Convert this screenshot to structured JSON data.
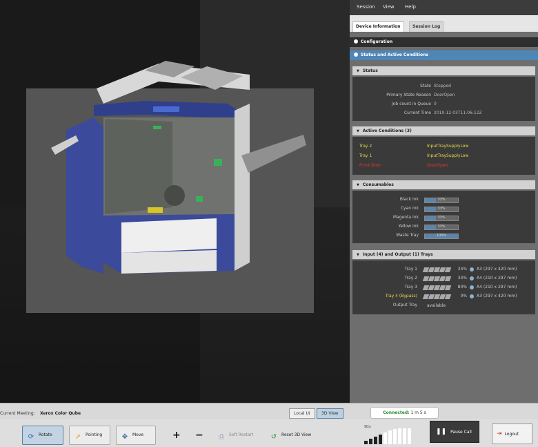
{
  "menu": {
    "session": "Session",
    "view": "View",
    "help": "Help"
  },
  "tabs": {
    "device_info": "Device Information",
    "session_log": "Session Log"
  },
  "sections": {
    "configuration": "Configuration",
    "status_and_conditions": "Status and Active Conditions",
    "status": "Status",
    "active_conditions": "Active Conditions (3)",
    "consumables": "Consumables",
    "trays": "Input (4) and Output (1) Trays"
  },
  "status": {
    "state_label": "State",
    "state": "Stopped",
    "reason_label": "Primary State Reason",
    "reason": "DoorOpen",
    "jobs_label": "Job count in Queue",
    "jobs": "0",
    "time_label": "Current Time",
    "time": "2010-12-03T11:06:12Z"
  },
  "conditions": [
    {
      "name": "Tray 2",
      "value": "InputTraySupplyLow",
      "color": "#e6d94a"
    },
    {
      "name": "Tray 1",
      "value": "InputTraySupplyLow",
      "color": "#e6d94a"
    },
    {
      "name": "Front Door",
      "value": "DoorOpen",
      "color": "#e03a2a"
    }
  ],
  "consumables": [
    {
      "label": "Black Ink",
      "pct": "33%",
      "fill": 0.33
    },
    {
      "label": "Cyan Ink",
      "pct": "33%",
      "fill": 0.33
    },
    {
      "label": "Magenta Ink",
      "pct": "33%",
      "fill": 0.33
    },
    {
      "label": "Yellow Ink",
      "pct": "33%",
      "fill": 0.33
    },
    {
      "label": "Waste Tray",
      "pct": "100%",
      "fill": 1.0
    }
  ],
  "trays": [
    {
      "name": "Tray 1",
      "pct": "34%",
      "size": "A3 (297 x 420 mm)",
      "color": "#cccccc"
    },
    {
      "name": "Tray 2",
      "pct": "34%",
      "size": "A4 (210 x 297 mm)",
      "color": "#cccccc"
    },
    {
      "name": "Tray 3",
      "pct": "80%",
      "size": "A4 (210 x 297 mm)",
      "color": "#cccccc"
    },
    {
      "name": "Tray 4 (Bypass)",
      "pct": "0%",
      "size": "A3 (297 x 420 mm)",
      "color": "#e6d94a"
    }
  ],
  "output_tray": {
    "name": "Output Tray",
    "value": "available"
  },
  "status_bar": {
    "meeting_label": "Current Meeting:",
    "meeting_value": "Xerox Color Qube",
    "local_ui": "Local UI",
    "view_3d": "3D View",
    "connected_label": "Connected:",
    "connected_time": "1 m 5 s"
  },
  "toolbar": {
    "rotate": "Rotate",
    "pointing": "Pointing",
    "move": "Move",
    "plus": "+",
    "minus": "−",
    "soft_rsvst": "Soft Restart",
    "reset_3d": "Reset 3D View",
    "signal": "Stts",
    "pause_call": "Pause Call",
    "logout": "Logout"
  }
}
